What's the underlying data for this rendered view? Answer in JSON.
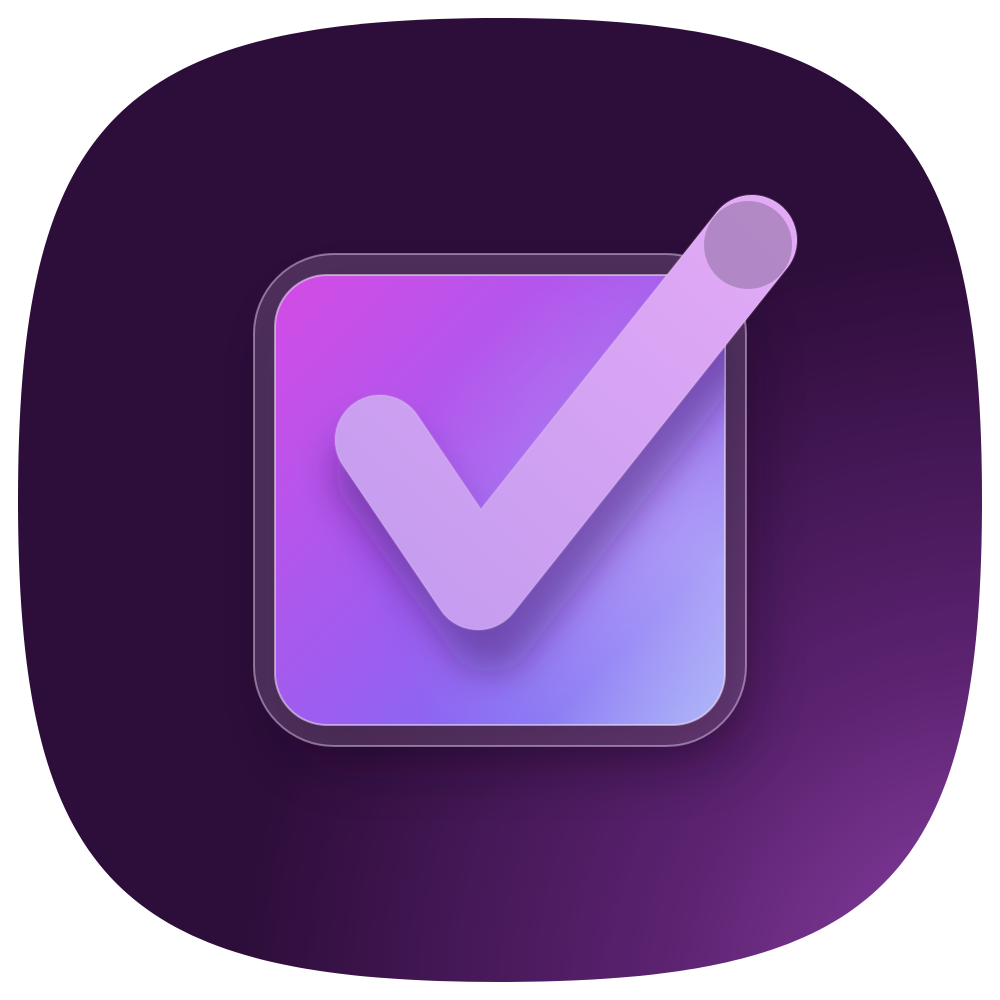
{
  "icon": {
    "name": "checkbox-checked-icon",
    "state": "checked"
  },
  "colors": {
    "background_dark": "#2d0d3a",
    "background_glow": "#8e43a8",
    "box_top_left": "#d44be6",
    "box_mid": "#9a5ef0",
    "box_bottom_right": "#9ea8f7",
    "box_frame": "#e7c9f7",
    "check_light": "#e2a9f6",
    "check_base": "#c49cef"
  }
}
